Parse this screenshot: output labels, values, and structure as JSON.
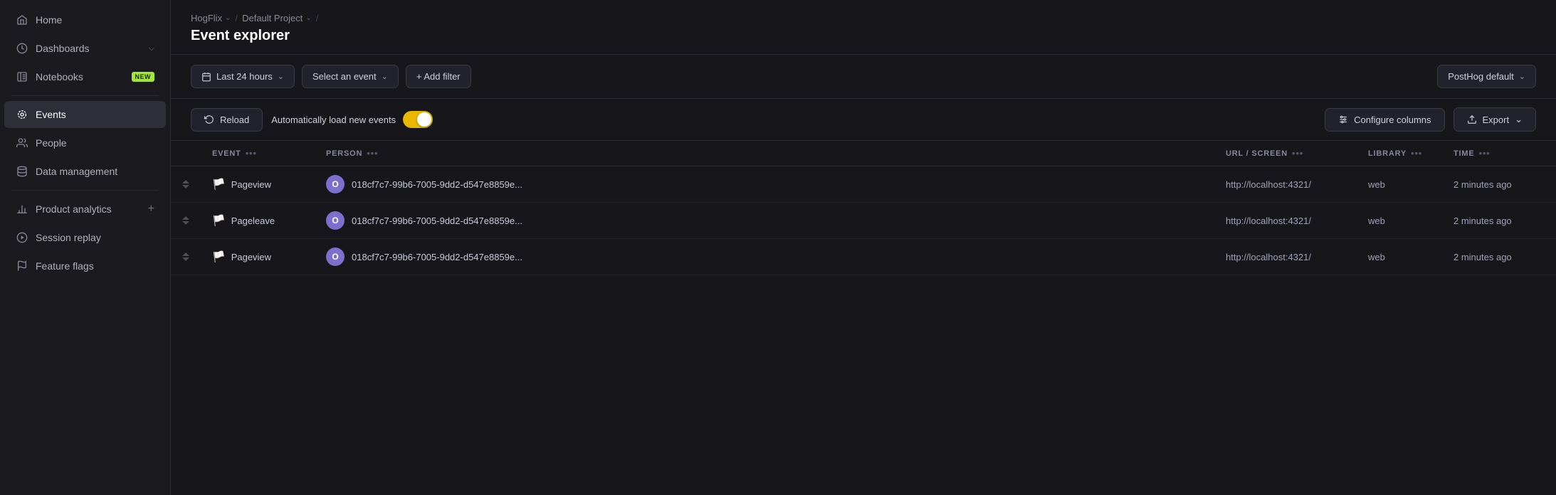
{
  "sidebar": {
    "items": [
      {
        "id": "home",
        "label": "Home",
        "icon": "home",
        "active": false
      },
      {
        "id": "dashboards",
        "label": "Dashboards",
        "icon": "dashboards",
        "active": false,
        "hasChevron": true
      },
      {
        "id": "notebooks",
        "label": "Notebooks",
        "icon": "notebooks",
        "active": false,
        "badge": "NEW"
      },
      {
        "id": "events",
        "label": "Events",
        "icon": "events",
        "active": true
      },
      {
        "id": "people",
        "label": "People",
        "icon": "people",
        "active": false
      },
      {
        "id": "data-management",
        "label": "Data management",
        "icon": "data",
        "active": false
      },
      {
        "id": "product-analytics",
        "label": "Product analytics",
        "icon": "analytics",
        "active": false,
        "hasPlus": true
      },
      {
        "id": "session-replay",
        "label": "Session replay",
        "icon": "replay",
        "active": false
      },
      {
        "id": "feature-flags",
        "label": "Feature flags",
        "icon": "flags",
        "active": false
      }
    ]
  },
  "breadcrumb": {
    "items": [
      {
        "label": "HogFlix",
        "hasChevron": true
      },
      {
        "label": "Default Project",
        "hasChevron": true
      }
    ]
  },
  "page": {
    "title": "Event explorer"
  },
  "toolbar": {
    "time_filter": "Last 24 hours",
    "event_select": "Select an event",
    "add_filter": "+ Add filter",
    "cluster_select": "PostHog default"
  },
  "actions": {
    "reload_label": "Reload",
    "auto_load_label": "Automatically load new events",
    "configure_label": "Configure columns",
    "export_label": "Export"
  },
  "table": {
    "columns": [
      {
        "id": "expand",
        "label": ""
      },
      {
        "id": "event",
        "label": "EVENT"
      },
      {
        "id": "person",
        "label": "PERSON"
      },
      {
        "id": "url",
        "label": "URL / SCREEN"
      },
      {
        "id": "library",
        "label": "LIBRARY"
      },
      {
        "id": "time",
        "label": "TIME"
      }
    ],
    "rows": [
      {
        "event": "Pageview",
        "event_emoji": "🏳️",
        "person_id": "018cf7c7-99b6-7005-9dd2-d547e8859e...",
        "person_avatar": "O",
        "url": "http://localhost:4321/",
        "library": "web",
        "time": "2 minutes ago"
      },
      {
        "event": "Pageleave",
        "event_emoji": "🏳️",
        "person_id": "018cf7c7-99b6-7005-9dd2-d547e8859e...",
        "person_avatar": "O",
        "url": "http://localhost:4321/",
        "library": "web",
        "time": "2 minutes ago"
      },
      {
        "event": "Pageview",
        "event_emoji": "🏳️",
        "person_id": "018cf7c7-99b6-7005-9dd2-d547e8859e...",
        "person_avatar": "O",
        "url": "http://localhost:4321/",
        "library": "web",
        "time": "2 minutes ago"
      }
    ]
  }
}
